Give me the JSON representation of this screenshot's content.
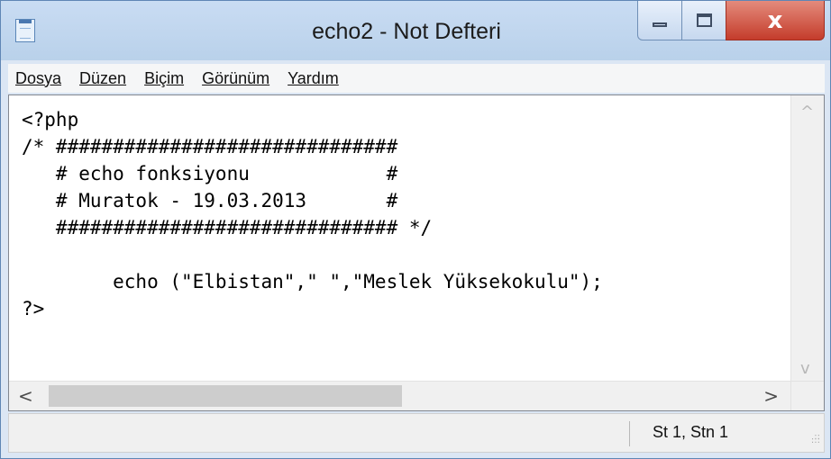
{
  "window": {
    "title": "echo2 - Not Defteri",
    "minimize_icon": "minimize-icon",
    "maximize_icon": "maximize-icon",
    "close_icon": "close-icon"
  },
  "menu": {
    "items": [
      "Dosya",
      "Düzen",
      "Biçim",
      "Görünüm",
      "Yardım"
    ]
  },
  "editor": {
    "text": "<?php\n/* ##############################\n   # echo fonksiyonu            #\n   # Muratok - 19.03.2013       #\n   ############################## */\n\n        echo (\"Elbistan\",\" \",\"Meslek Yüksekokulu\");\n?>"
  },
  "scrollbars": {
    "up_arrow": "^",
    "down_arrow": "v",
    "left_arrow": "<",
    "right_arrow": ">"
  },
  "status": {
    "cursor": "St 1, Stn 1",
    "grip_icon": "resize-grip-icon"
  }
}
